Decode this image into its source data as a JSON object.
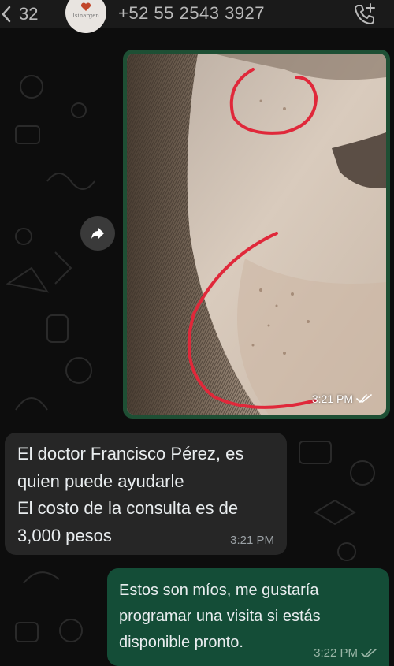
{
  "header": {
    "back_count": "32",
    "contact_title": "+52 55 2543 3927",
    "avatar_brand": "Isinargen",
    "back_icon": "chevron-left-icon",
    "call_icon": "phone-plus-icon"
  },
  "messages": {
    "image_message": {
      "time": "3:21 PM",
      "status_icon": "double-check-icon"
    },
    "incoming": {
      "lines": [
        "El doctor Francisco Pérez, es",
        "quien puede ayudarle",
        "El costo de la consulta es de",
        "3,000 pesos"
      ],
      "time": "3:21 PM"
    },
    "outgoing": {
      "lines": [
        "Estos son míos, me gustaría",
        "programar una visita si estás",
        "disponible pronto."
      ],
      "time": "3:22 PM",
      "status_icon": "double-check-icon"
    }
  },
  "colors": {
    "outgoing_bubble": "#144d37",
    "incoming_bubble": "#262626",
    "background": "#0d0d0d",
    "annotation_red": "#e0283a"
  }
}
